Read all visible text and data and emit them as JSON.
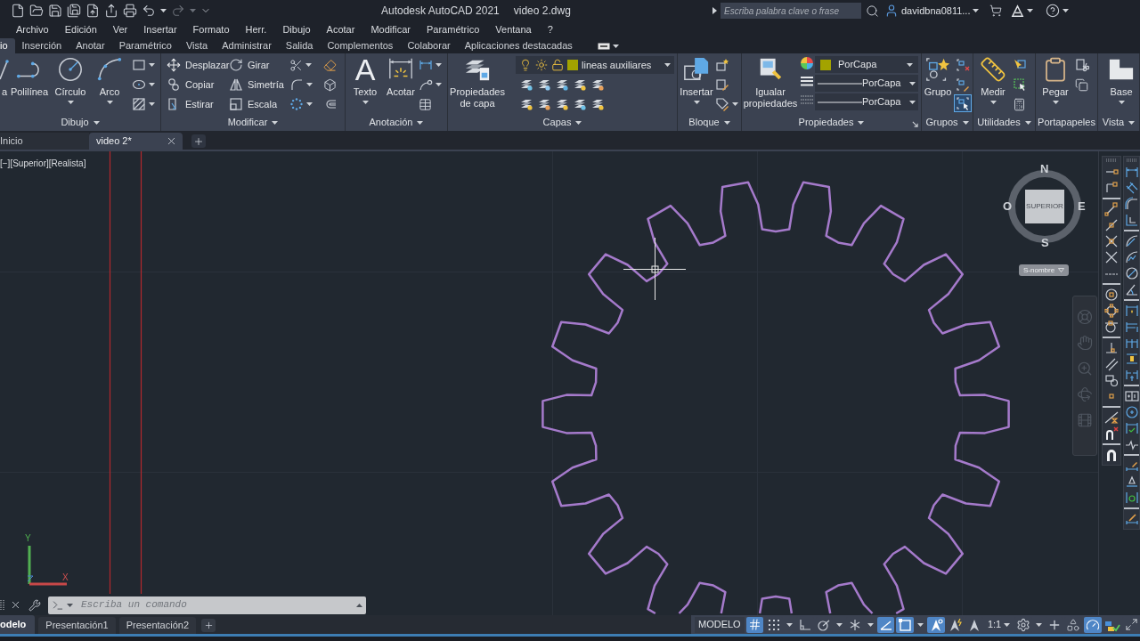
{
  "title_bar": {
    "app": "Autodesk AutoCAD 2021",
    "file": "video 2.dwg",
    "search": {
      "placeholder": "Escriba palabra clave o frase"
    },
    "user": "davidbna0811..."
  },
  "menu_bar": [
    "Archivo",
    "Edición",
    "Ver",
    "Insertar",
    "Formato",
    "Herr.",
    "Dibujo",
    "Acotar",
    "Modificar",
    "Paramétrico",
    "Ventana",
    "?"
  ],
  "ribbon_tabs": [
    {
      "label": "io",
      "selected": true
    },
    {
      "label": "Inserción",
      "selected": false
    },
    {
      "label": "Anotar",
      "selected": false
    },
    {
      "label": "Paramétrico",
      "selected": false
    },
    {
      "label": "Vista",
      "selected": false
    },
    {
      "label": "Administrar",
      "selected": false
    },
    {
      "label": "Salida",
      "selected": false
    },
    {
      "label": "Complementos",
      "selected": false
    },
    {
      "label": "Colaborar",
      "selected": false
    },
    {
      "label": "Aplicaciones destacadas",
      "selected": false
    }
  ],
  "ribbon_panels": [
    {
      "kind": "draw",
      "title": "Dibujo",
      "title_menu": true,
      "buttons": [
        {
          "label": "a",
          "dropdown": false
        },
        {
          "label": "Polilínea",
          "dropdown": false
        },
        {
          "label": "Círculo",
          "dropdown": true
        },
        {
          "label": "Arco",
          "dropdown": true
        }
      ]
    },
    {
      "kind": "modify",
      "title": "Modificar",
      "title_menu": true,
      "tools": [
        "Desplazar",
        "Girar",
        "Copiar",
        "Simetría",
        "Estirar",
        "Escala"
      ]
    },
    {
      "kind": "annotation",
      "title": "Anotación",
      "title_menu": true,
      "buttons": [
        {
          "label": "Texto",
          "glyph": "A",
          "dropdown": true
        },
        {
          "label": "Acotar",
          "dropdown": false
        }
      ]
    },
    {
      "kind": "layers",
      "title": "Capas",
      "title_menu": true,
      "buttons": [
        {
          "label": "Propiedades de capa",
          "dropdown": false
        }
      ],
      "layer": {
        "name": "lineas auxiliares",
        "color": "#a3a300"
      }
    },
    {
      "kind": "block",
      "title": "Bloque",
      "title_menu": true,
      "buttons": [
        {
          "label": "Insertar",
          "dropdown": true
        }
      ]
    },
    {
      "kind": "properties",
      "title": "Propiedades",
      "title_menu": true,
      "buttons": [
        {
          "label": "Igualar propiedades",
          "dropdown": false
        }
      ],
      "color": {
        "label": "PorCapa",
        "color": "#a3a300"
      },
      "linetype": "PorCapa",
      "lineweight": "PorCapa"
    },
    {
      "kind": "groups",
      "title": "Grupos",
      "title_menu": true,
      "buttons": [
        {
          "label": "Grupo",
          "dropdown": false
        }
      ],
      "selection_on": true
    },
    {
      "kind": "utilities",
      "title": "Utilidades",
      "title_menu": true,
      "buttons": [
        {
          "label": "Medir",
          "dropdown": true
        }
      ]
    },
    {
      "kind": "clipboard",
      "title": "Portapapeles",
      "title_menu": false,
      "buttons": [
        {
          "label": "Pegar",
          "dropdown": true
        }
      ]
    },
    {
      "kind": "view",
      "title": "Vista",
      "title_menu": true,
      "buttons": [
        {
          "label": "Base",
          "dropdown": true
        }
      ]
    }
  ],
  "file_tabs": [
    {
      "label": "Inicio",
      "selected": false
    },
    {
      "label": "video 2*",
      "selected": true
    }
  ],
  "viewport": {
    "controls": "[−][Superior][Realista]"
  },
  "viewcube": {
    "north": "N",
    "east": "E",
    "south": "S",
    "west": "O",
    "face": "SUPERIOR",
    "ucs_menu": "S-nombre"
  },
  "ucs_icon": {
    "y": "Y",
    "x": "X"
  },
  "command_line": {
    "placeholder": "Escriba un comando"
  },
  "layout_tabs": [
    {
      "label": "odelo",
      "selected": true
    },
    {
      "label": "Presentación1",
      "selected": false
    },
    {
      "label": "Presentación2",
      "selected": false
    }
  ],
  "status_bar": {
    "space": "MODELO",
    "items": [
      {
        "kind": "grid",
        "on": true,
        "menu": false
      },
      {
        "kind": "snap",
        "on": false,
        "menu": true
      },
      {
        "kind": "ortho",
        "on": false,
        "menu": false
      },
      {
        "kind": "polar",
        "on": false,
        "menu": true
      },
      {
        "kind": "isodraft",
        "on": false,
        "menu": true
      },
      {
        "kind": "tracking",
        "on": true,
        "menu": false
      },
      {
        "kind": "osnap",
        "on": true,
        "menu": true
      },
      {
        "kind": "annovisibility",
        "on": true,
        "menu": false
      },
      {
        "kind": "autoscale",
        "on": false,
        "menu": false
      },
      {
        "kind": "annoscale",
        "on": false,
        "menu": false
      },
      {
        "kind": "scale",
        "label": "1:1",
        "menu": true
      },
      {
        "kind": "workspace",
        "on": false,
        "menu": true
      },
      {
        "kind": "customize",
        "on": false,
        "menu": false
      },
      {
        "kind": "isolate",
        "on": false,
        "menu": false
      },
      {
        "kind": "hardware",
        "on": true,
        "menu": false
      },
      {
        "kind": "quickprops",
        "on": false,
        "menu": false
      },
      {
        "kind": "cleanscreen",
        "on": false,
        "menu": false
      }
    ]
  }
}
